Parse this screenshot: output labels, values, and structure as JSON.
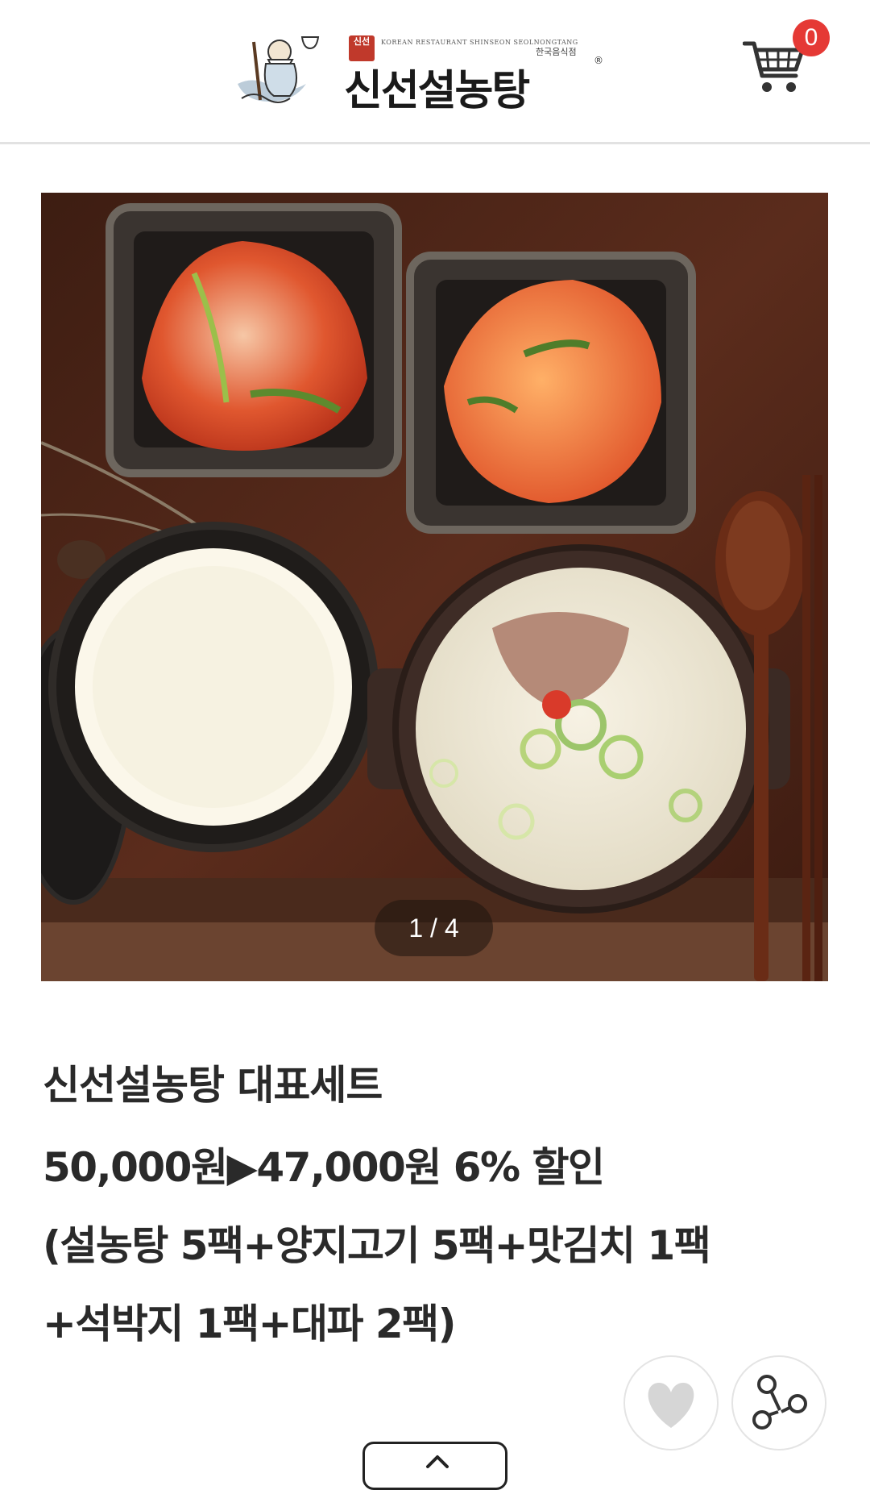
{
  "header": {
    "logo_seal": "신선",
    "logo_english": "KOREAN RESTAURANT SHINSEON SEOLNONGTANG",
    "logo_small_text": "한국음식점",
    "logo_name": "신선설농탕",
    "logo_registered": "®",
    "cart_icon": "shopping-cart-icon",
    "cart_count": "0",
    "badge_color": "#e53935"
  },
  "slider": {
    "current": "1",
    "total": "4",
    "counter_text": "1 / 4"
  },
  "product": {
    "title": "신선설농탕 대표세트",
    "price_line": "50,000원▶47,000원 6% 할인",
    "composition_line1": "(설농탕 5팩+양지고기 5팩+맛김치 1팩",
    "composition_line2": "+석박지 1팩+대파 2팩)"
  },
  "actions": {
    "like_icon": "heart-icon",
    "share_icon": "share-icon",
    "top_icon": "chevron-up-icon"
  }
}
